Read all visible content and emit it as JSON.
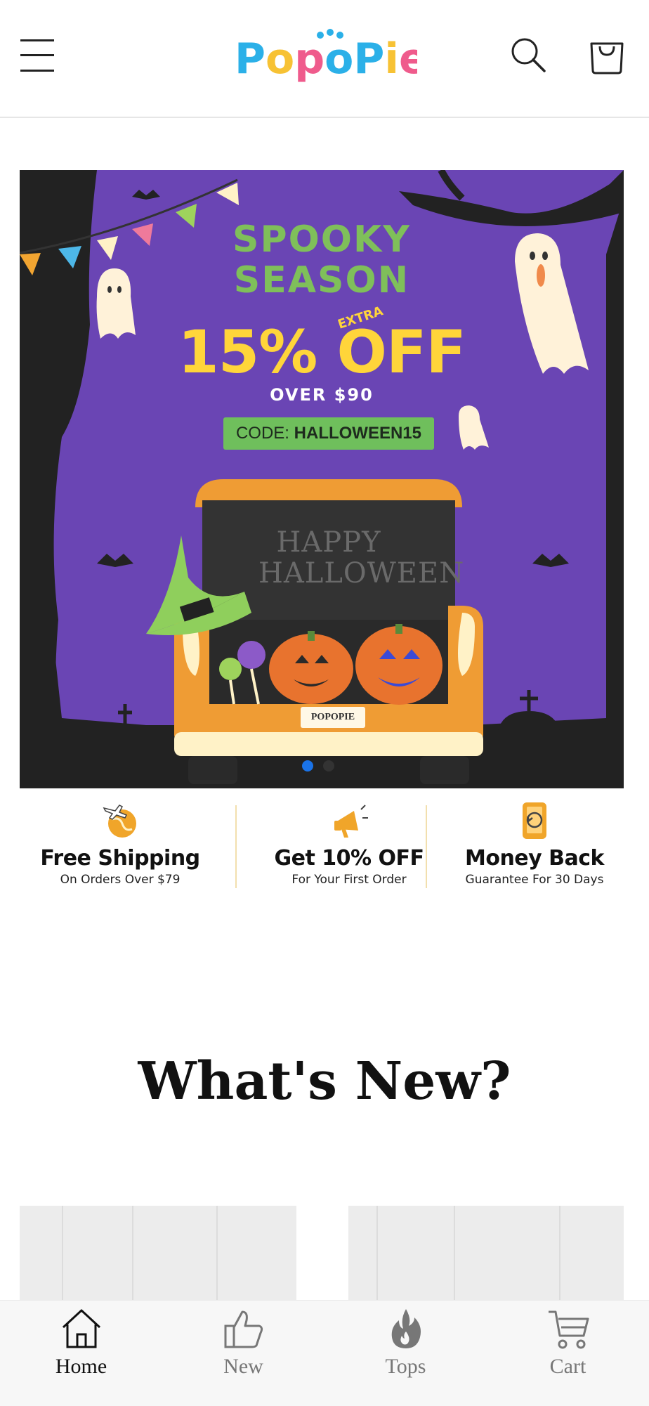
{
  "header": {
    "logo_text": "PoPoPie",
    "menu_icon": "hamburger-icon",
    "search_icon": "search-icon",
    "cart_icon": "bag-icon"
  },
  "banner": {
    "headline_line1": "SPOOKY",
    "headline_line2": "SEASON",
    "discount": "15% OFF",
    "extra_label": "EXTRA",
    "condition": "OVER $90",
    "code_label": "CODE:",
    "code_value": "HALLOWEEN15",
    "trunk_line1": "HAPPY",
    "trunk_line2": "HALLOWEEN",
    "plate": "POPOPIE",
    "slide_count": 2,
    "active_slide": 1
  },
  "perks": [
    {
      "icon": "globe-plane-icon",
      "title": "Free Shipping",
      "subtitle": "On Orders Over $79"
    },
    {
      "icon": "megaphone-icon",
      "title": "Get 10% OFF",
      "subtitle": "For Your First Order"
    },
    {
      "icon": "phone-refund-icon",
      "title": "Money Back",
      "subtitle": "Guarantee For 30 Days"
    }
  ],
  "section": {
    "title": "What's New?"
  },
  "bottom_nav": [
    {
      "label": "Home",
      "icon": "home-icon",
      "active": true
    },
    {
      "label": "New",
      "icon": "thumbs-up-icon",
      "active": false
    },
    {
      "label": "Tops",
      "icon": "flame-icon",
      "active": false
    },
    {
      "label": "Cart",
      "icon": "cart-icon",
      "active": false
    }
  ],
  "colors": {
    "banner_purple": "#6a45b4",
    "headline_green": "#7fbf5a",
    "discount_yellow": "#ffd53a",
    "active_dot": "#1a73e8",
    "perk_icon": "#f0a52a"
  }
}
